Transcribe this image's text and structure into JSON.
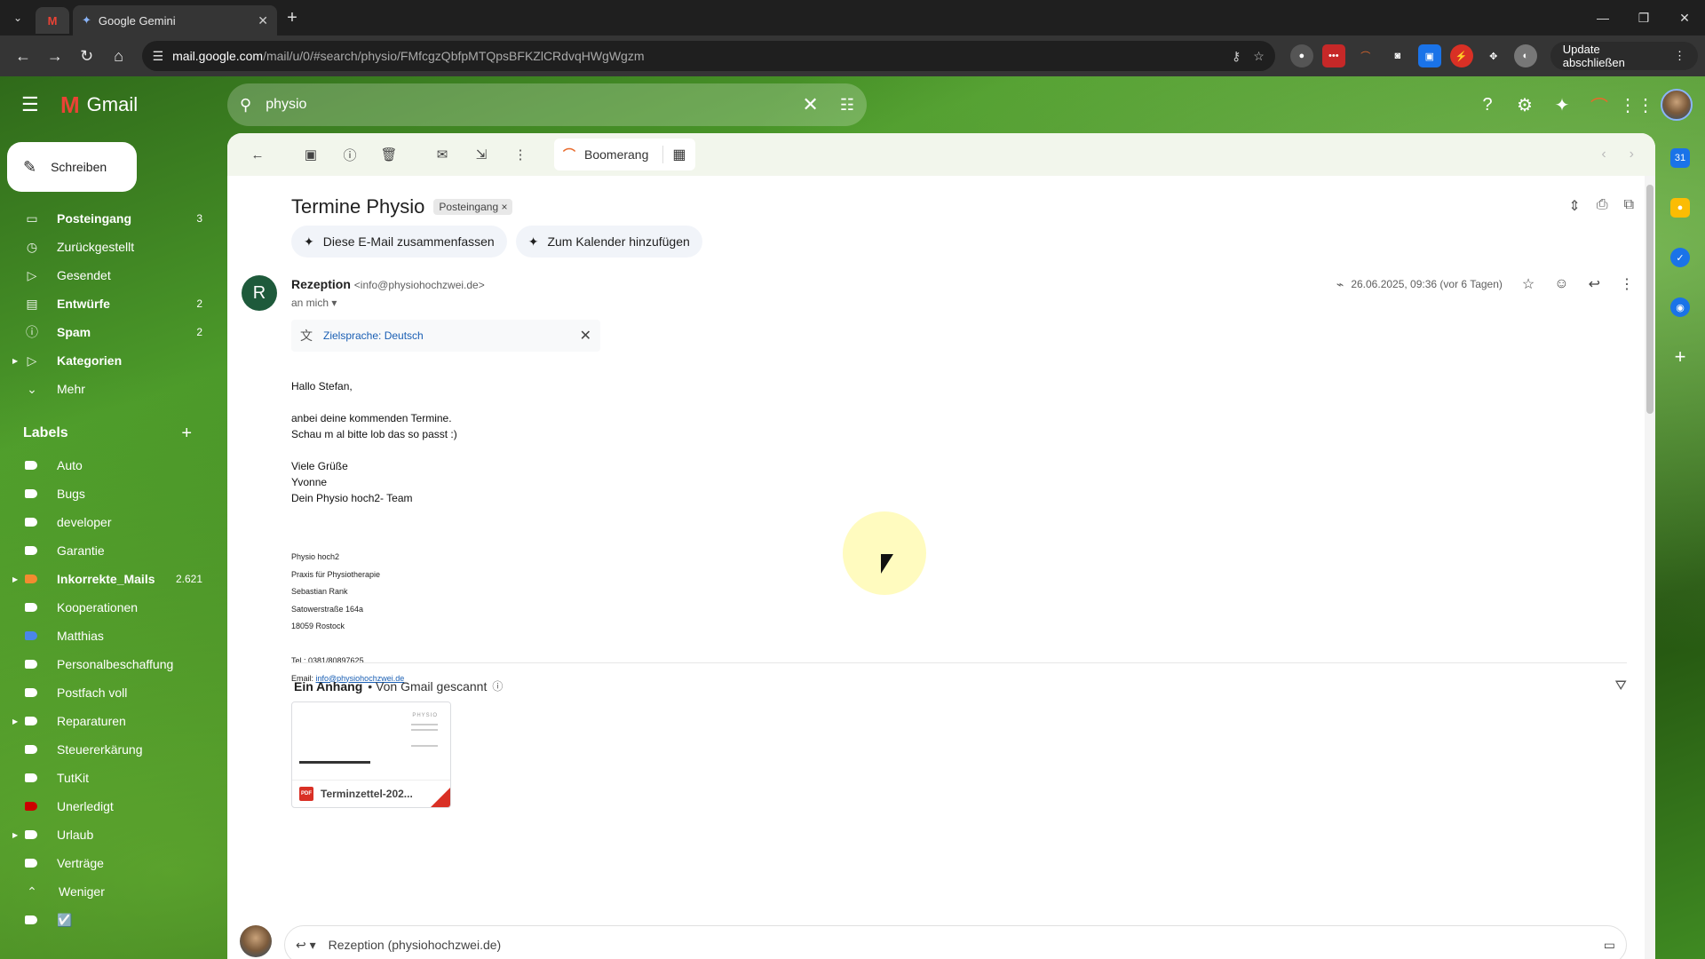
{
  "browser": {
    "tab_title": "Google Gemini",
    "url_host": "mail.google.com",
    "url_path": "/mail/u/0/#search/physio/FMfcgzQbfpMTQpsBFKZlCRdvqHWgWgzm",
    "update_label": "Update abschließen"
  },
  "gmail": {
    "brand": "Gmail",
    "search": {
      "query": "physio"
    },
    "compose_label": "Schreiben",
    "nav": [
      {
        "label": "Posteingang",
        "count": "3",
        "icon": "inbox-icon",
        "bold": true
      },
      {
        "label": "Zurückgestellt",
        "count": "",
        "icon": "clock-icon",
        "bold": false
      },
      {
        "label": "Gesendet",
        "count": "",
        "icon": "send-icon",
        "bold": false
      },
      {
        "label": "Entwürfe",
        "count": "2",
        "icon": "draft-icon",
        "bold": true
      },
      {
        "label": "Spam",
        "count": "2",
        "icon": "spam-icon",
        "bold": true
      },
      {
        "label": "Kategorien",
        "count": "",
        "icon": "label-icon",
        "bold": true
      },
      {
        "label": "Mehr",
        "count": "",
        "icon": "chevron-down-icon",
        "bold": false
      }
    ],
    "labels_heading": "Labels",
    "labels": [
      {
        "label": "Auto",
        "count": "",
        "color": "#ffffff"
      },
      {
        "label": "Bugs",
        "count": "",
        "color": "#ffffff"
      },
      {
        "label": "developer",
        "count": "",
        "color": "#ffffff"
      },
      {
        "label": "Garantie",
        "count": "",
        "color": "#ffffff"
      },
      {
        "label": "Inkorrekte_Mails",
        "count": "2.621",
        "color": "#f28b30"
      },
      {
        "label": "Kooperationen",
        "count": "",
        "color": "#ffffff"
      },
      {
        "label": "Matthias",
        "count": "",
        "color": "#4a86e8"
      },
      {
        "label": "Personalbeschaffung",
        "count": "",
        "color": "#ffffff"
      },
      {
        "label": "Postfach voll",
        "count": "",
        "color": "#ffffff"
      },
      {
        "label": "Reparaturen",
        "count": "",
        "color": "#ffffff"
      },
      {
        "label": "Steuererkärung",
        "count": "",
        "color": "#ffffff"
      },
      {
        "label": "TutKit",
        "count": "",
        "color": "#ffffff"
      },
      {
        "label": "Unerledigt",
        "count": "",
        "color": "#cc0000"
      },
      {
        "label": "Urlaub",
        "count": "",
        "color": "#ffffff"
      },
      {
        "label": "Verträge",
        "count": "",
        "color": "#ffffff"
      },
      {
        "label": "Weniger",
        "count": "",
        "color": ""
      },
      {
        "label": "☑️",
        "count": "",
        "color": "#ffffff"
      }
    ],
    "toolbar": {
      "boomerang_label": "Boomerang"
    },
    "message": {
      "subject": "Termine Physio",
      "inbox_chip": "Posteingang",
      "ai_summarize": "Diese E-Mail zusammenfassen",
      "ai_calendar": "Zum Kalender hinzufügen",
      "sender_initial": "R",
      "sender_name": "Rezeption",
      "sender_email": "<info@physiohochzwei.de>",
      "to": "an mich",
      "date": "26.06.2025, 09:36 (vor 6 Tagen)",
      "translate_label": "Zielsprache: Deutsch",
      "body": [
        "Hallo Stefan,",
        "",
        "anbei deine kommenden Termine.",
        "Schau m al bitte lob das so passt :)",
        "",
        "Viele Grüße",
        "Yvonne",
        "Dein Physio hoch2- Team"
      ],
      "signature": [
        "Physio hoch2",
        "Praxis für Physiotherapie",
        "Sebastian Rank",
        "Satowerstraße 164a",
        "18059 Rostock"
      ],
      "tel": "Tel.: 0381/80897625",
      "email_label": "Email: ",
      "email_link": "info@physiohochzwei.de",
      "attachment_heading": "Ein Anhang",
      "attachment_scanned": " • Von Gmail gescannt",
      "attachment_name": "Terminzettel-202...",
      "attachment_preview_logo": "PHYSIO",
      "reply_to": "Rezeption (physiohochzwei.de)"
    }
  }
}
